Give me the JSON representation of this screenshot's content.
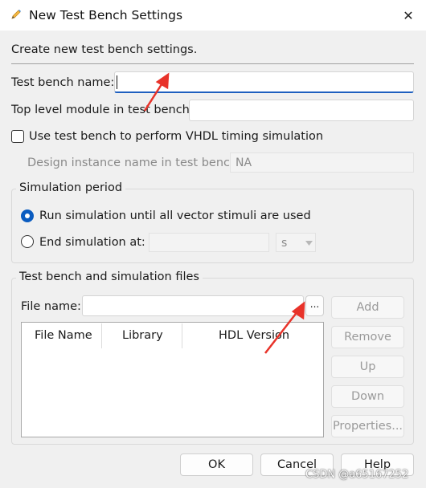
{
  "window": {
    "title": "New Test Bench Settings",
    "close_glyph": "✕",
    "title_icon": "pencil-icon",
    "close_icon": "close-icon"
  },
  "header": {
    "description": "Create new test bench settings."
  },
  "form": {
    "test_bench_name_label": "Test bench name:",
    "test_bench_name_value": "",
    "top_level_module_label": "Top level module in test bench:",
    "top_level_module_value": "",
    "vhdl_timing_checkbox_label": "Use test bench to perform VHDL timing simulation",
    "vhdl_timing_checked": false,
    "design_instance_label": "Design instance name in test bench:",
    "design_instance_value": "NA"
  },
  "simulation_period": {
    "title": "Simulation period",
    "run_until_label": "Run simulation until all vector stimuli are used",
    "run_until_selected": true,
    "end_at_label": "End simulation at:",
    "end_at_value": "",
    "unit_value": "s"
  },
  "files": {
    "title": "Test bench and simulation files",
    "file_name_label": "File name:",
    "file_name_value": "",
    "browse_label": "...",
    "columns": [
      "File Name",
      "Library",
      "HDL Version"
    ],
    "rows": [],
    "buttons": {
      "add": "Add",
      "remove": "Remove",
      "up": "Up",
      "down": "Down",
      "properties": "Properties..."
    }
  },
  "footer": {
    "ok": "OK",
    "cancel": "Cancel",
    "help": "Help"
  },
  "watermark": "CSDN @a65167252",
  "annotation_color": "#e8332a",
  "accent_color": "#0b5cc0"
}
